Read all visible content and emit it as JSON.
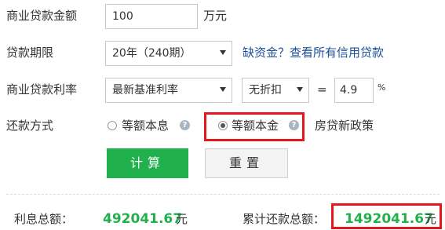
{
  "loan_amount": {
    "label": "商业贷款金额",
    "value": "100",
    "unit": "万元"
  },
  "loan_term": {
    "label": "贷款期限",
    "selected": "20年（240期）",
    "link": "缺资金？查看所有信用贷款"
  },
  "interest_rate": {
    "label": "商业贷款利率",
    "rate_type": "最新基准利率",
    "discount": "无折扣",
    "equals": "=",
    "value": "4.9",
    "unit": "%"
  },
  "repayment": {
    "label": "还款方式",
    "options": [
      {
        "label": "等额本息",
        "selected": false
      },
      {
        "label": "等额本金",
        "selected": true
      }
    ],
    "help_glyph": "?",
    "policy_link": "房贷新政策"
  },
  "buttons": {
    "calculate": "计算",
    "reset": "重置"
  },
  "results": {
    "interest_label": "利息总额：",
    "interest_value": "492041.67",
    "interest_unit": "元",
    "total_label": "累计还款总额：",
    "total_value": "1492041.67",
    "total_unit": "元"
  },
  "colors": {
    "accent_green": "#21b14c",
    "highlight_red": "#e8161c",
    "link_blue": "#1e4f9c"
  }
}
